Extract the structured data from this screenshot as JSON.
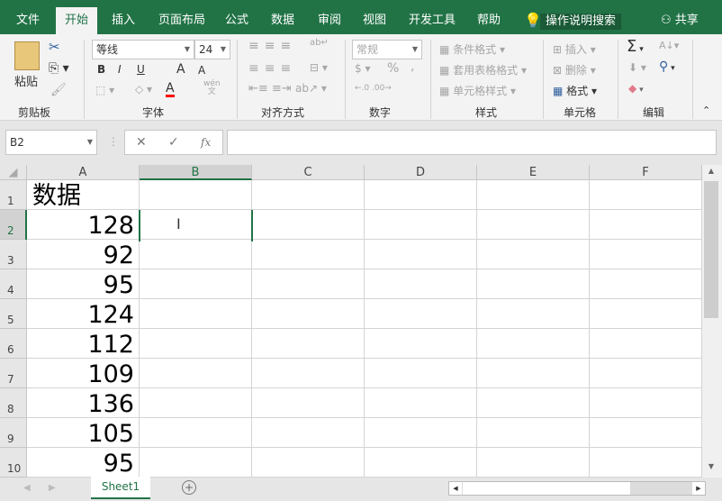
{
  "tabs": [
    "文件",
    "开始",
    "插入",
    "页面布局",
    "公式",
    "数据",
    "审阅",
    "视图",
    "开发工具",
    "帮助"
  ],
  "active_tab": "开始",
  "tell_me": "操作说明搜索",
  "share": "共享",
  "clipboard": {
    "paste": "粘贴",
    "group": "剪贴板"
  },
  "font": {
    "name": "等线",
    "size": "24",
    "bold": "B",
    "italic": "I",
    "underline": "U",
    "grow": "A",
    "shrink": "A",
    "color": "A",
    "phonetic_top": "wén",
    "phonetic_bottom": "文",
    "group": "字体",
    "font_color_hex": "#ff0000"
  },
  "alignment": {
    "group": "对齐方式"
  },
  "number": {
    "format": "常规",
    "percent": "%",
    "comma": ",",
    "group": "数字"
  },
  "styles": {
    "conditional": "条件格式",
    "table": "套用表格格式",
    "cell": "单元格样式",
    "group": "样式"
  },
  "cells": {
    "insert": "插入",
    "delete": "删除",
    "format": "格式",
    "group": "单元格"
  },
  "editing": {
    "group": "编辑"
  },
  "formula_bar": {
    "name_box": "B2",
    "cancel": "✕",
    "enter": "✓",
    "fx": "fx",
    "value": ""
  },
  "columns": [
    "A",
    "B",
    "C",
    "D",
    "E",
    "F"
  ],
  "rows": [
    "1",
    "2",
    "3",
    "4",
    "5",
    "6",
    "7",
    "8",
    "9",
    "10"
  ],
  "column_a": [
    "数据",
    "128",
    "92",
    "95",
    "124",
    "112",
    "109",
    "136",
    "105",
    "95"
  ],
  "selected_cell": "B2",
  "sheets": [
    "Sheet1"
  ],
  "accent": "#217346"
}
